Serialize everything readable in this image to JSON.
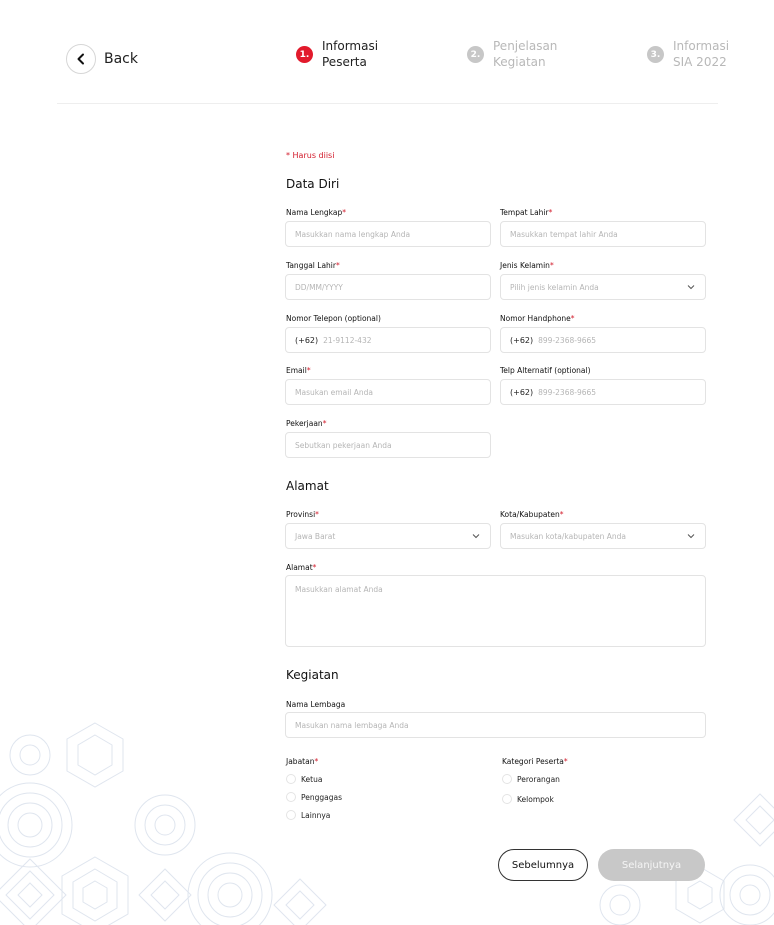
{
  "header": {
    "back_label": "Back",
    "steps": [
      {
        "num": "1.",
        "label": "Informasi Peserta",
        "state": "active"
      },
      {
        "num": "2.",
        "label": "Penjelasan Kegiatan",
        "state": "inactive"
      },
      {
        "num": "3.",
        "label": "Informasi SIA 2022",
        "state": "inactive"
      }
    ]
  },
  "form": {
    "required_note": "* Harus diisi",
    "sections": {
      "data_diri": "Data Diri",
      "alamat": "Alamat",
      "kegiatan": "Kegiatan"
    },
    "fields": {
      "nama_lengkap": {
        "label": "Nama Lengkap",
        "req": "*",
        "placeholder": "Masukkan nama lengkap Anda"
      },
      "tempat_lahir": {
        "label": "Tempat Lahir",
        "req": "*",
        "placeholder": "Masukkan tempat lahir Anda"
      },
      "tanggal_lahir": {
        "label": "Tanggal Lahir",
        "req": "*",
        "placeholder": "DD/MM/YYYY"
      },
      "jenis_kelamin": {
        "label": "Jenis Kelamin",
        "req": "*",
        "placeholder": "Pilih jenis kelamin Anda"
      },
      "nomor_telepon": {
        "label": "Nomor Telepon (optional)",
        "prefix": "(+62)",
        "placeholder": "21-9112-432"
      },
      "nomor_handphone": {
        "label": "Nomor Handphone",
        "req": "*",
        "prefix": "(+62)",
        "placeholder": "899-2368-9665"
      },
      "email": {
        "label": "Email",
        "req": "*",
        "placeholder": "Masukan email Anda"
      },
      "telp_alternatif": {
        "label": "Telp Alternatif (optional)",
        "prefix": "(+62)",
        "placeholder": "899-2368-9665"
      },
      "pekerjaan": {
        "label": "Pekerjaan",
        "req": "*",
        "placeholder": "Sebutkan pekerjaan Anda"
      },
      "provinsi": {
        "label": "Provinsi",
        "req": "*",
        "value": "Jawa Barat"
      },
      "kota": {
        "label": "Kota/Kabupaten",
        "req": "*",
        "placeholder": "Masukan kota/kabupaten Anda"
      },
      "alamat": {
        "label": "Alamat",
        "req": "*",
        "placeholder": "Masukkan alamat Anda"
      },
      "nama_lembaga": {
        "label": "Nama Lembaga",
        "placeholder": "Masukan nama lembaga Anda"
      },
      "jabatan": {
        "label": "Jabatan",
        "req": "*",
        "options": [
          "Ketua",
          "Penggagas",
          "Lainnya"
        ]
      },
      "kategori_peserta": {
        "label": "Kategori Peserta",
        "req": "*",
        "options": [
          "Perorangan",
          "Kelompok"
        ]
      }
    }
  },
  "buttons": {
    "prev_label": "Sebelumnya",
    "next_label": "Selanjutnya"
  },
  "colors": {
    "accent_red": "#e21a2c",
    "inactive_gray": "#c7c7c7",
    "disabled_button": "#c8c8c8"
  },
  "icons": {
    "back": "chevron-left-icon",
    "dropdown": "chevron-down-icon"
  }
}
